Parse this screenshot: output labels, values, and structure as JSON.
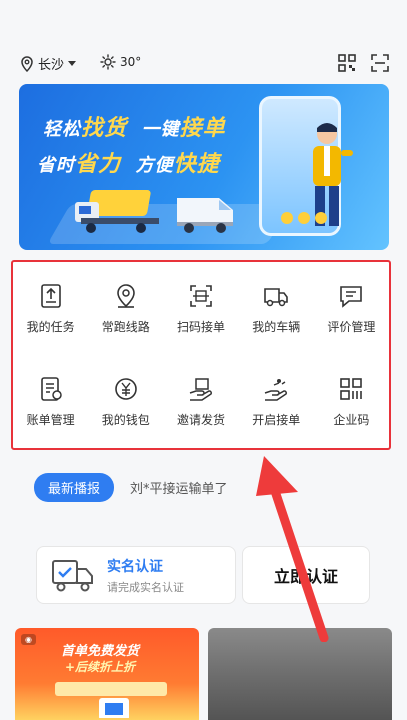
{
  "header": {
    "city": "长沙",
    "temperature": "30°"
  },
  "banner": {
    "line1_a": "轻松",
    "line1_b": "找货",
    "line1_c": "一键",
    "line1_d": "接单",
    "line2_a": "省时",
    "line2_b": "省力",
    "line2_c": "方便",
    "line2_d": "快捷"
  },
  "menu": [
    {
      "label": "我的任务",
      "icon": "task-icon"
    },
    {
      "label": "常跑线路",
      "icon": "route-pin-icon"
    },
    {
      "label": "扫码接单",
      "icon": "scan-order-icon"
    },
    {
      "label": "我的车辆",
      "icon": "truck-icon"
    },
    {
      "label": "评价管理",
      "icon": "review-icon"
    },
    {
      "label": "账单管理",
      "icon": "bill-icon"
    },
    {
      "label": "我的钱包",
      "icon": "wallet-yen-icon"
    },
    {
      "label": "邀请发货",
      "icon": "invite-icon"
    },
    {
      "label": "开启接单",
      "icon": "start-order-icon"
    },
    {
      "label": "企业码",
      "icon": "enterprise-code-icon"
    }
  ],
  "news": {
    "badge": "最新播报",
    "text": "刘*平接运输单了"
  },
  "verify": {
    "title": "实名认证",
    "subtitle": "请完成实名认证",
    "button": "立即认证"
  },
  "promo": {
    "line1": "首单免费发货",
    "line2": "+后续折上折"
  },
  "colors": {
    "accent": "#2f7df1",
    "highlight": "#e8323a",
    "banner_text_highlight": "#ffd84d"
  }
}
